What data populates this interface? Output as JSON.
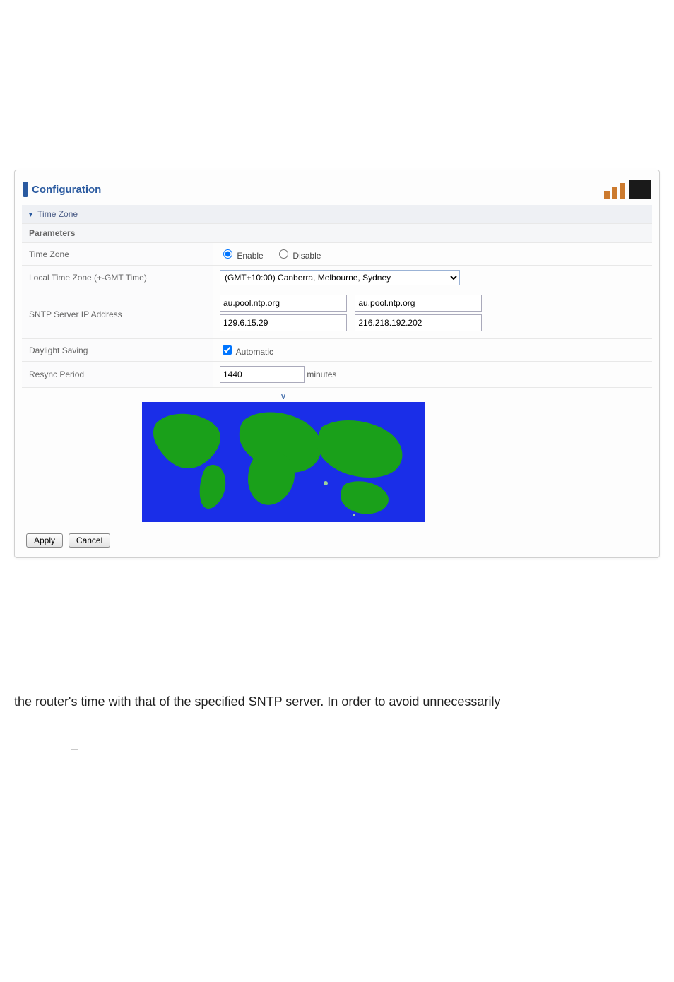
{
  "panel": {
    "title": "Configuration",
    "section": "Time Zone",
    "parametersHeader": "Parameters",
    "rows": {
      "timeZone": {
        "label": "Time Zone",
        "options": {
          "enable": "Enable",
          "disable": "Disable"
        },
        "selected": "enable"
      },
      "localTimeZone": {
        "label": "Local Time Zone (+-GMT Time)",
        "value": "(GMT+10:00) Canberra, Melbourne, Sydney"
      },
      "sntp": {
        "label": "SNTP Server IP Address",
        "servers": {
          "s1": "au.pool.ntp.org",
          "s2": "au.pool.ntp.org",
          "s3": "129.6.15.29",
          "s4": "216.218.192.202"
        }
      },
      "daylight": {
        "label": "Daylight Saving",
        "checkboxLabel": "Automatic",
        "checked": true
      },
      "resync": {
        "label": "Resync Period",
        "value": "1440",
        "unit": "minutes"
      }
    },
    "buttons": {
      "apply": "Apply",
      "cancel": "Cancel"
    }
  },
  "paragraph": {
    "text": "the router's time with that of the specified SNTP server. In order to avoid unnecessarily",
    "dash": "–"
  }
}
